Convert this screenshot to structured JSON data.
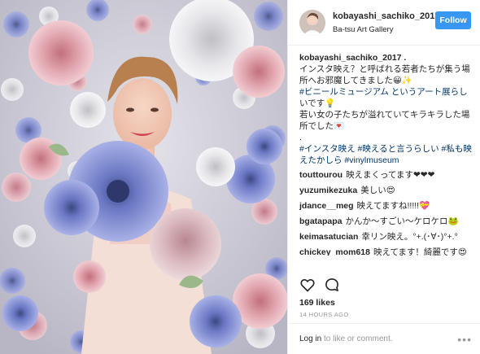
{
  "post_header": {
    "username": "kobayashi_sachiko_2017",
    "location": "Ba-tsu Art Gallery",
    "follow_label": "Follow"
  },
  "caption": {
    "username": "kobayashi_sachiko_2017",
    "username_suffix": " .",
    "lines": [
      "インスタ映え？と呼ばれる若者たちが集う場",
      "所へお邪魔してきました😀✨",
      "#ビニールミュージアム というアート展らし",
      "いです💡",
      "若い女の子たちが溢れていてキラキラした場",
      "所でした💌",
      ".",
      "#インスタ映え #映えると言うらしい #私も映",
      "えたかしら #vinylmuseum"
    ]
  },
  "comments": [
    {
      "user": "touttourou",
      "text": "映えまくってます❤❤❤"
    },
    {
      "user": "yuzumikezuka",
      "text": "美しい😍"
    },
    {
      "user": "jdance__meg",
      "text": "映えてますね!!!!!💝"
    },
    {
      "user": "bgatapapa",
      "text": "かんか〜すごい〜ケロケロ🐸"
    },
    {
      "user": "keimasatucian",
      "text": "幸リン映え。°+.(･∀･)°+.°"
    },
    {
      "user": "chickey_mom618",
      "text": "映えてます！綺麗です😍"
    }
  ],
  "likes_text": "169 likes",
  "timestamp": "14 HOURS AGO",
  "login": {
    "login_link": "Log in",
    "rest": " to like or comment."
  },
  "icons": {
    "like": "heart-outline-icon",
    "comment": "speech-bubble-icon",
    "more": "ellipsis-icon"
  },
  "colors": {
    "follow_button": "#3897f0",
    "text": "#262626",
    "muted": "#999999",
    "hashtag": "#003569"
  }
}
